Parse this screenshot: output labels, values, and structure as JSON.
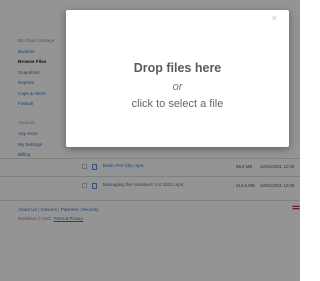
{
  "sidebar": {
    "section1_heading": "B2 Cloud Storage",
    "items1": [
      {
        "label": "Buckets"
      },
      {
        "label": "Browse Files"
      },
      {
        "label": "Snapshots"
      },
      {
        "label": "Reports"
      },
      {
        "label": "Caps & Alerts"
      },
      {
        "label": "Fireball"
      }
    ],
    "section2_heading": "Account",
    "items2": [
      {
        "label": "App Keys"
      },
      {
        "label": "My Settings"
      },
      {
        "label": "Billing"
      }
    ]
  },
  "files": [
    {
      "name": "Basic Pet Clip.mp4",
      "size": "86.8 MB",
      "date": "12/01/2021 12:00"
    },
    {
      "name": "Managing the Numbers 3 8 2021.mp4",
      "size": "214.5 MB",
      "date": "12/01/2021 12:00"
    }
  ],
  "footer": {
    "about": "About Us",
    "careers": "Careers",
    "partners": "Partners",
    "security": "Security",
    "sep": "|",
    "copyright": "Backblaze © 2022.",
    "terms": "Terms & Privacy"
  },
  "modal": {
    "close": "×",
    "title": "Drop files here",
    "or": "or",
    "click_text": "click to select a file"
  },
  "colors": {
    "link": "#3b6fb6",
    "overlay": "rgba(0,0,0,0.40)"
  }
}
